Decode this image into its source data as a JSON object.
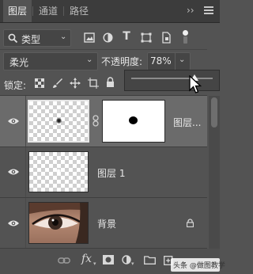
{
  "tabs": [
    {
      "label": "图层",
      "active": true
    },
    {
      "label": "通道",
      "active": false
    },
    {
      "label": "路径",
      "active": false
    }
  ],
  "panel_controls": {
    "collapse": "››",
    "menu_icon": "hamburger-icon"
  },
  "filter": {
    "kind_label": "类型",
    "icons": [
      "image-filter-icon",
      "adjustment-filter-icon",
      "type-filter-icon",
      "shape-filter-icon",
      "smart-object-filter-icon",
      "filter-toggle-icon"
    ]
  },
  "blend": {
    "mode": "柔光"
  },
  "opacity": {
    "label": "不透明度:",
    "value": "78%",
    "level": 0.78
  },
  "lock": {
    "label": "锁定:",
    "icons": [
      "lock-transparent-icon",
      "lock-pixels-icon",
      "lock-position-icon",
      "lock-artboard-icon",
      "lock-all-icon"
    ]
  },
  "layers": [
    {
      "name": "图层...",
      "selected": true,
      "has_mask": true,
      "linked": true,
      "visible": true
    },
    {
      "name": "图层 1",
      "selected": false,
      "has_mask": false,
      "visible": true
    },
    {
      "name": "背景",
      "selected": false,
      "locked": true,
      "visible": true
    }
  ],
  "bottom_icons": [
    "link-layers-icon",
    "fx-icon",
    "add-mask-icon",
    "adjustment-layer-icon",
    "group-icon",
    "new-layer-icon",
    "delete-icon"
  ],
  "fx_label": "fx",
  "watermark": "头条 @做图教学",
  "colors": {
    "panel_bg": "#535353",
    "selected_row": "#6b6b6b",
    "tab_bar": "#3c3c3c"
  }
}
